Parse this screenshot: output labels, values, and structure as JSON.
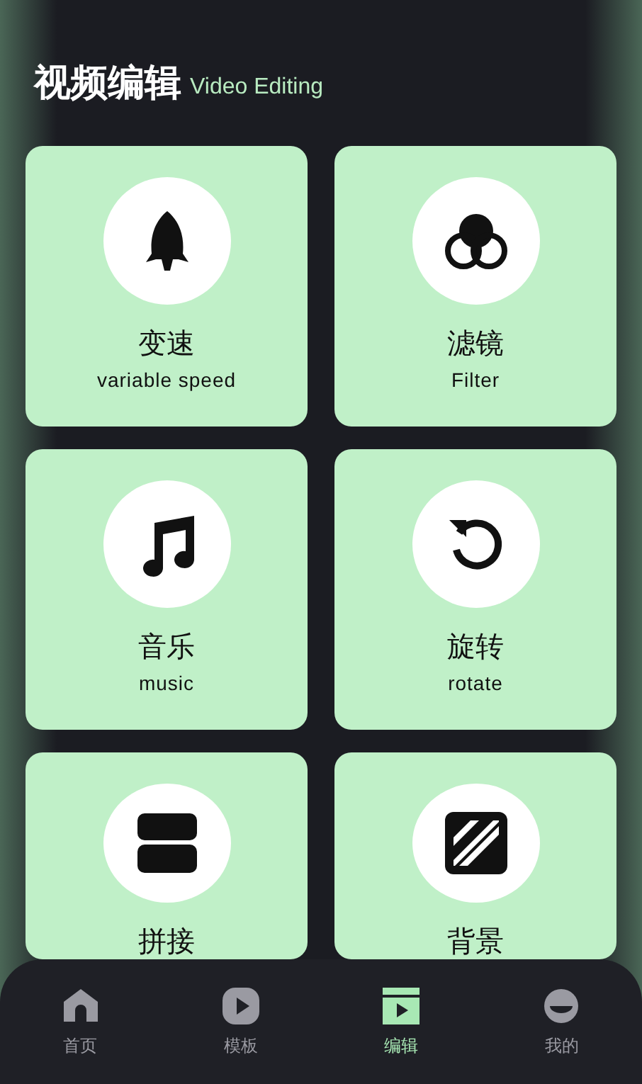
{
  "header": {
    "title": "视频编辑",
    "subtitle": "Video Editing"
  },
  "tools": [
    {
      "kind": "rocket",
      "label": "变速",
      "subtitle": "variable speed"
    },
    {
      "kind": "filter",
      "label": "滤镜",
      "subtitle": "Filter"
    },
    {
      "kind": "music",
      "label": "音乐",
      "subtitle": "music"
    },
    {
      "kind": "rotate",
      "label": "旋转",
      "subtitle": "rotate"
    },
    {
      "kind": "split",
      "label": "拼接"
    },
    {
      "kind": "background",
      "label": "背景"
    }
  ],
  "tab_bar": [
    {
      "kind": "home",
      "label": "首页",
      "selected": false
    },
    {
      "kind": "template",
      "label": "模板",
      "selected": false
    },
    {
      "kind": "edit",
      "label": "编辑",
      "selected": true
    },
    {
      "kind": "profile",
      "label": "我的",
      "selected": false
    }
  ]
}
